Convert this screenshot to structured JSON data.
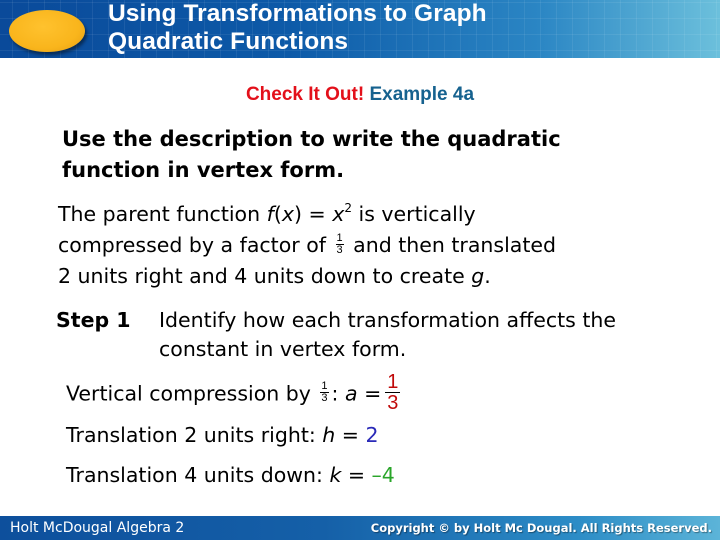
{
  "header": {
    "title_line1": "Using Transformations to Graph",
    "title_line2": "Quadratic Functions",
    "logo_icon": "orange-oval"
  },
  "subtitle": {
    "label": "Check It Out!",
    "example": "Example 4a",
    "label_color": "#e3101a",
    "example_color": "#16628f"
  },
  "prompt": {
    "line1": "Use the description to write the quadratic",
    "line2": "function in vertex form."
  },
  "description": {
    "p1": "The parent function ",
    "fn": "f",
    "fn_arg_open": "(",
    "fn_var": "x",
    "fn_arg_close": ")",
    "eq": " = ",
    "x": "x",
    "exp": "2",
    "p2": " is vertically",
    "p3": "compressed by a factor of",
    "frac_num": "1",
    "frac_den": "3",
    "p4": "and then translated",
    "p5": "2 units right and 4 units down to create ",
    "g": "g",
    "period": "."
  },
  "step": {
    "label": "Step 1",
    "text": "Identify how each transformation affects the constant in vertex form."
  },
  "lines": {
    "compression": {
      "text": "Vertical compression by",
      "frac_num": "1",
      "frac_den": "3",
      "colon": ": ",
      "var": "a",
      "eq": " =",
      "val_num": "1",
      "val_den": "3",
      "val_color": "#c00a0a"
    },
    "right": {
      "text": "Translation 2 units right: ",
      "var": "h",
      "eq": " = ",
      "val": "2",
      "val_color": "#2a2ab8"
    },
    "down": {
      "text": "Translation 4 units down: ",
      "var": "k",
      "eq": " = ",
      "val": "–4",
      "val_color": "#2aa52a"
    }
  },
  "footer": {
    "left": "Holt McDougal Algebra 2",
    "right": "Copyright © by Holt Mc Dougal. All Rights Reserved."
  }
}
